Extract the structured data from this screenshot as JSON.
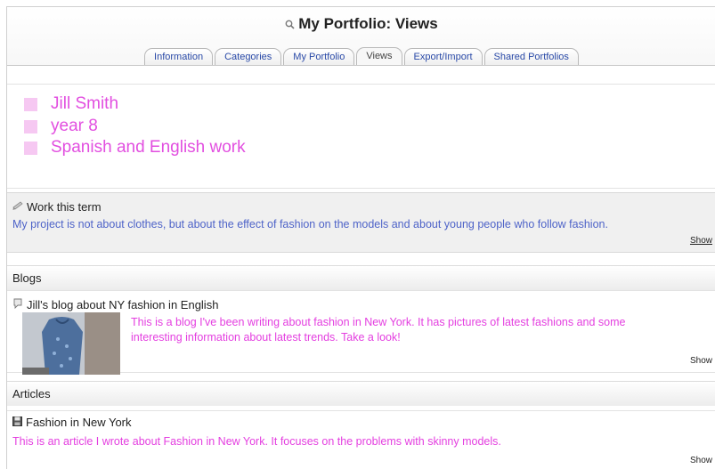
{
  "header": {
    "title": "My Portfolio: Views",
    "tabs": [
      {
        "label": "Information"
      },
      {
        "label": "Categories"
      },
      {
        "label": "My Portfolio"
      },
      {
        "label": "Views",
        "active": true
      },
      {
        "label": "Export/Import"
      },
      {
        "label": "Shared Portfolios"
      }
    ]
  },
  "intro": {
    "lines": [
      "Jill Smith",
      "year 8",
      "Spanish and English work"
    ],
    "bullet_color": "#f6c8f2",
    "text_color": "#e24fe0"
  },
  "work_term": {
    "title": "Work this term",
    "description": "My project is not about clothes, but about the effect of fashion on the models and about young people who follow fashion.",
    "show": "Show"
  },
  "blogs": {
    "heading": "Blogs",
    "item": {
      "title": "Jill's blog about NY fashion in English",
      "line1": "This is a blog I've been writing about fashion in New York. It has pictures of latest fashions and some",
      "line2": "interesting information about latest trends. Take a look!",
      "show": "Show"
    }
  },
  "articles": {
    "heading": "Articles",
    "item": {
      "title": "Fashion in New York",
      "description": "This is an article I wrote about Fashion in New York. It focuses on the problems with skinny models.",
      "show": "Show"
    }
  },
  "colors": {
    "link_blue": "#2a4aa8",
    "description_blue": "#4e63c8",
    "pink": "#e43fe0"
  }
}
